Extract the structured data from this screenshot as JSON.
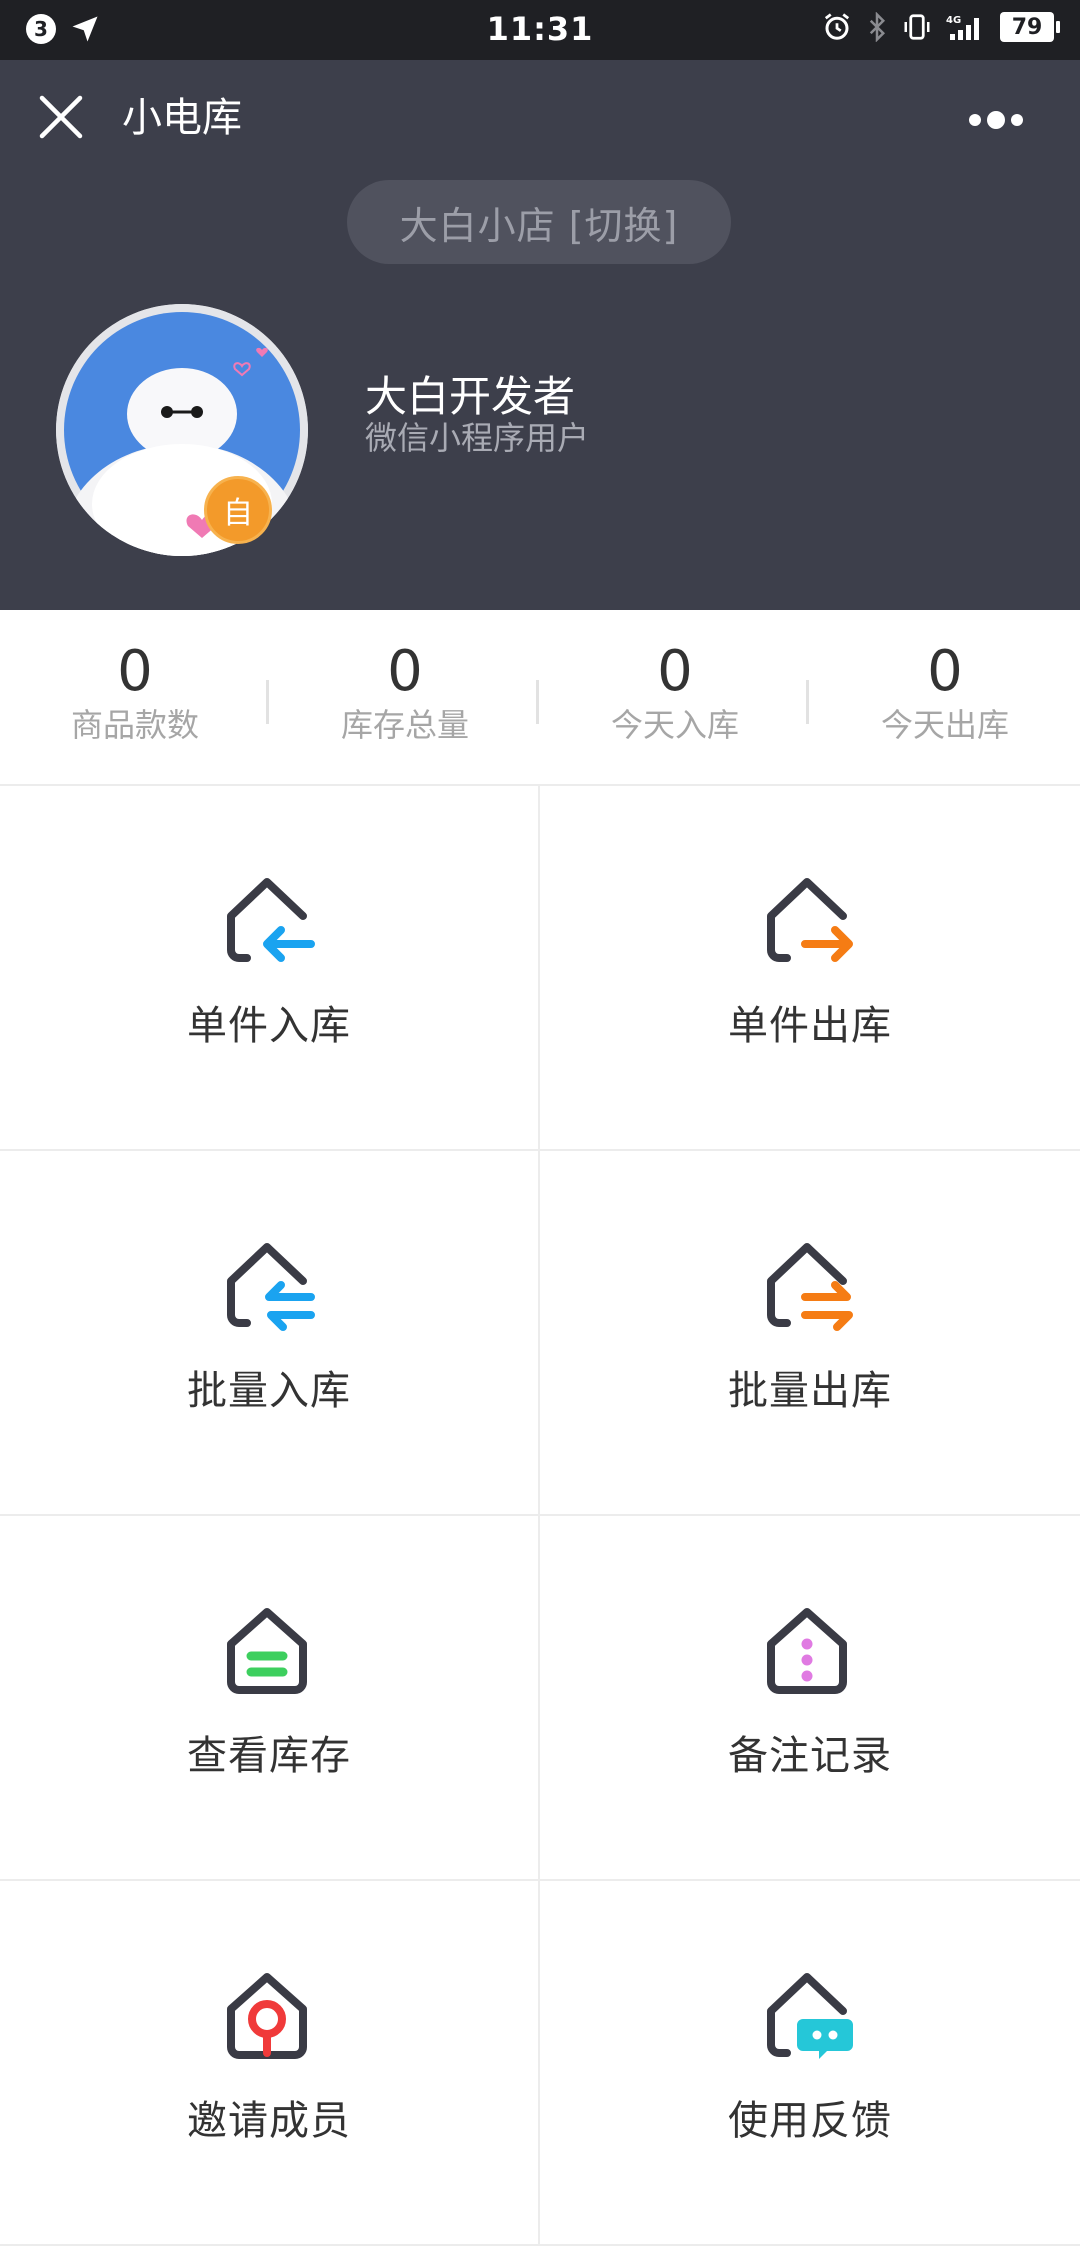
{
  "status_bar": {
    "notification_count": "3",
    "time": "11:31",
    "network": "4G",
    "battery": "79"
  },
  "nav": {
    "title": "小电库",
    "close_icon": "close-icon",
    "more_icon": "more-icon"
  },
  "store": {
    "switch_label": "大白小店 [切换]"
  },
  "user": {
    "name": "大白开发者",
    "subtitle": "微信小程序用户",
    "badge": "自"
  },
  "stats": [
    {
      "value": "0",
      "label": "商品款数"
    },
    {
      "value": "0",
      "label": "库存总量"
    },
    {
      "value": "0",
      "label": "今天入库"
    },
    {
      "value": "0",
      "label": "今天出库"
    }
  ],
  "menu": [
    {
      "label": "单件入库",
      "icon": "house-arrow-in-icon",
      "accent": "#1aa3f0"
    },
    {
      "label": "单件出库",
      "icon": "house-arrow-out-icon",
      "accent": "#f57c14"
    },
    {
      "label": "批量入库",
      "icon": "house-double-arrow-in-icon",
      "accent": "#1aa3f0"
    },
    {
      "label": "批量出库",
      "icon": "house-double-arrow-out-icon",
      "accent": "#f57c14"
    },
    {
      "label": "查看库存",
      "icon": "house-lines-icon",
      "accent": "#3dcf5e"
    },
    {
      "label": "备注记录",
      "icon": "house-dots-icon",
      "accent": "#e07ae2"
    },
    {
      "label": "邀请成员",
      "icon": "house-location-icon",
      "accent": "#f03a3a"
    },
    {
      "label": "使用反馈",
      "icon": "house-chat-icon",
      "accent": "#25c7d8"
    }
  ],
  "colors": {
    "header_bg": "#3d3f4b",
    "status_bar_bg": "#1f2024",
    "icon_dark": "#3a3b45"
  }
}
